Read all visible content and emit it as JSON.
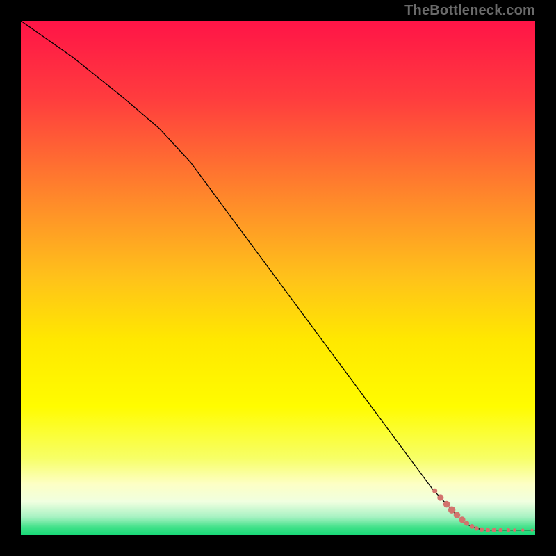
{
  "watermark": "TheBottleneck.com",
  "chart_data": {
    "type": "line",
    "title": "",
    "xlabel": "",
    "ylabel": "",
    "xlim": [
      0,
      100
    ],
    "ylim": [
      0,
      100
    ],
    "grid": false,
    "legend": false,
    "background": {
      "type": "vertical-gradient",
      "stops": [
        {
          "pos": 0.0,
          "color": "#ff1447"
        },
        {
          "pos": 0.15,
          "color": "#ff3c3e"
        },
        {
          "pos": 0.35,
          "color": "#ff8a2a"
        },
        {
          "pos": 0.5,
          "color": "#ffc21a"
        },
        {
          "pos": 0.62,
          "color": "#ffe800"
        },
        {
          "pos": 0.75,
          "color": "#fffc00"
        },
        {
          "pos": 0.85,
          "color": "#f7ff66"
        },
        {
          "pos": 0.9,
          "color": "#fdffc4"
        },
        {
          "pos": 0.935,
          "color": "#f0ffe0"
        },
        {
          "pos": 0.965,
          "color": "#a6f2c2"
        },
        {
          "pos": 0.985,
          "color": "#3fe188"
        },
        {
          "pos": 1.0,
          "color": "#17d977"
        }
      ]
    },
    "series": [
      {
        "name": "bottleneck-curve",
        "stroke": "#000000",
        "stroke_width": 1.3,
        "x": [
          0,
          10,
          20,
          27,
          33,
          40,
          50,
          60,
          70,
          80,
          86,
          88,
          90,
          92,
          95,
          98,
          100
        ],
        "y": [
          100,
          93,
          85,
          79,
          72.5,
          63,
          49.5,
          36,
          22.5,
          9,
          2.5,
          1.5,
          1.0,
          1.0,
          1.0,
          1.0,
          1.0
        ]
      }
    ],
    "points": {
      "name": "data-points",
      "color": "#d2736d",
      "radius_range": [
        2.0,
        5.2
      ],
      "items": [
        {
          "x": 80.5,
          "y": 8.6,
          "r": 3.6
        },
        {
          "x": 81.6,
          "y": 7.3,
          "r": 4.6
        },
        {
          "x": 82.8,
          "y": 6.0,
          "r": 4.8
        },
        {
          "x": 83.8,
          "y": 4.9,
          "r": 5.2
        },
        {
          "x": 84.8,
          "y": 3.9,
          "r": 4.8
        },
        {
          "x": 85.8,
          "y": 3.0,
          "r": 4.6
        },
        {
          "x": 86.7,
          "y": 2.3,
          "r": 3.6
        },
        {
          "x": 87.7,
          "y": 1.7,
          "r": 3.4
        },
        {
          "x": 88.6,
          "y": 1.3,
          "r": 3.2
        },
        {
          "x": 89.6,
          "y": 1.1,
          "r": 3.2
        },
        {
          "x": 90.8,
          "y": 1.0,
          "r": 3.2
        },
        {
          "x": 92.0,
          "y": 1.0,
          "r": 3.2
        },
        {
          "x": 93.3,
          "y": 1.0,
          "r": 3.0
        },
        {
          "x": 94.8,
          "y": 1.0,
          "r": 2.8
        },
        {
          "x": 96.0,
          "y": 1.0,
          "r": 2.4
        },
        {
          "x": 97.6,
          "y": 1.0,
          "r": 2.2
        },
        {
          "x": 99.4,
          "y": 1.0,
          "r": 2.0
        }
      ]
    }
  }
}
